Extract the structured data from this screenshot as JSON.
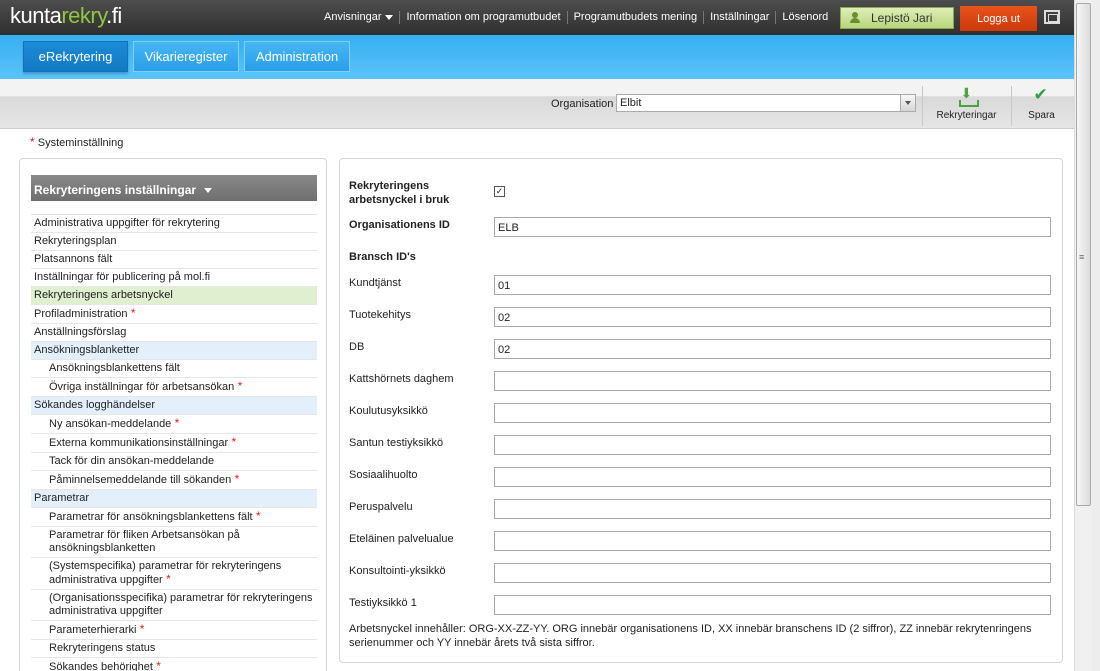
{
  "brand": {
    "logo_main": "kunta",
    "logo_tail": "rekry",
    "logo_domain": ".fi"
  },
  "topnav": {
    "items": [
      "Anvisningar",
      "Information om programutbudet",
      "Programutbudets mening",
      "Inställningar",
      "Lösenord"
    ],
    "user_name": "Lepistö Jari",
    "logout_label": "Logga ut"
  },
  "tabs": [
    "eRekrytering",
    "Vikarieregister",
    "Administration"
  ],
  "toolbar": {
    "org_label": "Organisation",
    "org_value": "Elbit",
    "rekryteringar_label": "Rekryteringar",
    "spara_label": "Spara"
  },
  "system_note": "Systeminställning",
  "sidebar": {
    "title": "Rekryteringens inställningar",
    "items": [
      {
        "label": "Administrativa uppgifter för rekrytering",
        "indent": false,
        "star": false
      },
      {
        "label": "Rekryteringsplan",
        "indent": false,
        "star": false
      },
      {
        "label": "Platsannons fält",
        "indent": false,
        "star": false
      },
      {
        "label": "Inställningar för publicering på mol.fi",
        "indent": false,
        "star": false
      },
      {
        "label": "Rekryteringens arbetsnyckel",
        "indent": false,
        "star": false,
        "selected": true
      },
      {
        "label": "Profiladministration",
        "indent": false,
        "star": true
      },
      {
        "label": "Anställningsförslag",
        "indent": false,
        "star": false
      },
      {
        "label": "Ansökningsblanketter",
        "indent": false,
        "star": false,
        "section": true
      },
      {
        "label": "Ansökningsblankettens fält",
        "indent": true,
        "star": false
      },
      {
        "label": "Övriga inställningar för arbetsansökan",
        "indent": true,
        "star": true
      },
      {
        "label": "Sökandes logghändelser",
        "indent": false,
        "star": false,
        "section": true
      },
      {
        "label": "Ny ansökan-meddelande",
        "indent": true,
        "star": true
      },
      {
        "label": "Externa kommunikationsinställningar",
        "indent": true,
        "star": true
      },
      {
        "label": "Tack för din ansökan-meddelande",
        "indent": true,
        "star": false
      },
      {
        "label": "Påminnelsemeddelande till sökanden",
        "indent": true,
        "star": true
      },
      {
        "label": "Parametrar",
        "indent": false,
        "star": false,
        "section": true
      },
      {
        "label": "Parametrar för ansökningsblankettens fält",
        "indent": true,
        "star": true
      },
      {
        "label": "Parametrar för fliken Arbetsansökan på ansökningsblanketten",
        "indent": true,
        "star": false
      },
      {
        "label": "(Systemspecifika) parametrar för rekryteringens administrativa uppgifter",
        "indent": true,
        "star": true
      },
      {
        "label": "(Organisationsspecifika) parametrar för rekryteringens administrativa uppgifter",
        "indent": true,
        "star": false
      },
      {
        "label": "Parameterhierarki",
        "indent": true,
        "star": true
      },
      {
        "label": "Rekryteringens status",
        "indent": true,
        "star": false
      },
      {
        "label": "Sökandes behörighet",
        "indent": true,
        "star": true
      }
    ]
  },
  "form": {
    "key_in_use_label": "Rekryteringens arbetsnyckel i bruk",
    "key_in_use_checked": true,
    "checkbox_mark": "✓",
    "org_id_label": "Organisationens ID",
    "org_id_value": "ELB",
    "bransch_heading": "Bransch ID's",
    "branches": [
      {
        "label": "Kundtjänst",
        "value": "01"
      },
      {
        "label": "Tuotekehitys",
        "value": "02"
      },
      {
        "label": "DB",
        "value": "02"
      },
      {
        "label": "Kattshörnets daghem",
        "value": ""
      },
      {
        "label": "Koulutusyksikkö",
        "value": ""
      },
      {
        "label": "Santun testiyksikkö",
        "value": ""
      },
      {
        "label": "Sosiaalihuolto",
        "value": ""
      },
      {
        "label": "Peruspalvelu",
        "value": ""
      },
      {
        "label": "Eteläinen palvelualue",
        "value": ""
      },
      {
        "label": "Konsultointi-yksikkö",
        "value": ""
      },
      {
        "label": "Testiyksikkö 1",
        "value": ""
      }
    ],
    "note": "Arbetsnyckel innehåller: ORG-XX-ZZ-YY. ORG innebär organisationens ID, XX innebär branschens ID (2 siffror), ZZ innebär rekrytenringens serienummer och YY innebär årets två sista siffror."
  }
}
